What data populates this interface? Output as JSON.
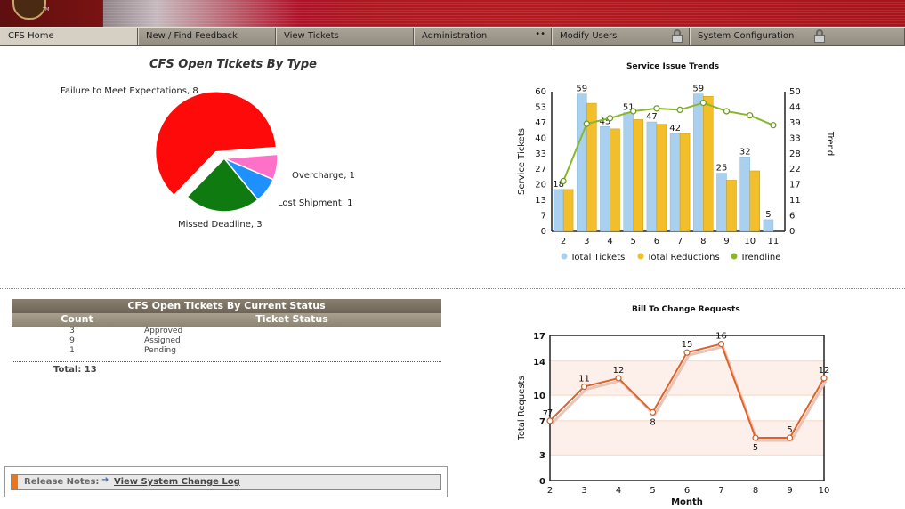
{
  "banner": {
    "logo_mark": "TM"
  },
  "nav": [
    {
      "label": "CFS Home",
      "active": true
    },
    {
      "label": "New / Find Feedback"
    },
    {
      "label": "View Tickets"
    },
    {
      "label": "Administration",
      "suffix": "••"
    },
    {
      "label": "Modify Users",
      "locked": true
    },
    {
      "label": "System Configuration",
      "locked": true
    }
  ],
  "pie_title": "CFS Open Tickets By Type",
  "trends_title": "Service Issue Trends",
  "bill_title": "Bill To Change Requests",
  "status_table": {
    "title": "CFS Open Tickets By Current Status",
    "col_count": "Count",
    "col_status": "Ticket Status",
    "rows": [
      {
        "count": "3",
        "status": "Approved"
      },
      {
        "count": "9",
        "status": "Assigned"
      },
      {
        "count": "1",
        "status": "Pending"
      }
    ],
    "total": "Total: 13"
  },
  "release": {
    "label": "Release Notes:",
    "link": "View System Change Log"
  },
  "colors": {
    "accent": "#e87722",
    "total_tickets": "#a9d1ef",
    "total_reductions": "#f2be2a",
    "trendline": "#88b82a",
    "bill_line": "#e0622a"
  },
  "chart_data": [
    {
      "type": "pie",
      "title": "CFS Open Tickets By Type",
      "slices": [
        {
          "label": "Failure to Meet Expectations, 8",
          "value": 8,
          "color": "#ff0a0a"
        },
        {
          "label": "Overcharge, 1",
          "value": 1,
          "color": "#ff70c8"
        },
        {
          "label": "Lost Shipment, 1",
          "value": 1,
          "color": "#1e90ff"
        },
        {
          "label": "Missed Deadline, 3",
          "value": 3,
          "color": "#0e7a10"
        }
      ]
    },
    {
      "type": "bar",
      "title": "Service Issue Trends",
      "categories": [
        "2",
        "3",
        "4",
        "5",
        "6",
        "7",
        "8",
        "9",
        "10",
        "11"
      ],
      "ylabel": "Service Tickets",
      "y2label": "Trend",
      "ylim": [
        0,
        60
      ],
      "y_ticks": [
        "0",
        "7",
        "13",
        "20",
        "27",
        "33",
        "40",
        "47",
        "53",
        "60"
      ],
      "y2lim": [
        0,
        50
      ],
      "y2_ticks": [
        "0",
        "6",
        "11",
        "17",
        "22",
        "28",
        "33",
        "39",
        "44",
        "50"
      ],
      "series": [
        {
          "name": "Total Tickets",
          "values": [
            18,
            59,
            45,
            51,
            47,
            42,
            59,
            25,
            32,
            5
          ],
          "labels": [
            "18",
            "59",
            "45",
            "51",
            "47",
            "42",
            "59",
            "25",
            "32",
            "5"
          ]
        },
        {
          "name": "Total Reductions",
          "values": [
            18,
            55,
            44,
            48,
            46,
            42,
            58,
            22,
            26,
            0
          ]
        },
        {
          "name": "Trendline",
          "axis": "y2",
          "values": [
            18,
            38.5,
            40.5,
            43,
            44,
            43.5,
            46,
            43,
            41.5,
            38
          ]
        }
      ],
      "legend": "bottom"
    },
    {
      "type": "line",
      "title": "Bill To Change Requests",
      "x": [
        "2",
        "3",
        "4",
        "5",
        "6",
        "7",
        "8",
        "9",
        "10"
      ],
      "values": [
        7,
        11,
        12,
        8,
        15,
        16,
        5,
        5,
        12
      ],
      "labels": [
        "7",
        "11",
        "12",
        "8",
        "15",
        "16",
        "5",
        "5",
        "12"
      ],
      "extra_label": "7",
      "xlabel": "Month",
      "ylabel": "Total Requests",
      "ylim": [
        0,
        17
      ],
      "y_ticks": [
        "0",
        "3",
        "7",
        "10",
        "14",
        "17"
      ]
    }
  ]
}
